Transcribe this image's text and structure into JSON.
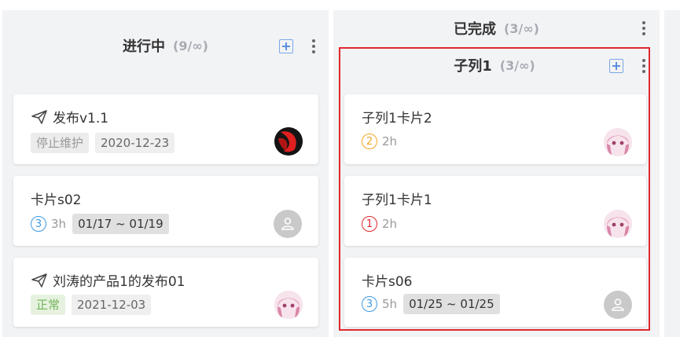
{
  "columns": {
    "in_progress": {
      "title": "进行中",
      "count": "(9/∞)"
    },
    "done": {
      "title": "已完成",
      "count": "(3/∞)"
    },
    "sub1": {
      "title": "子列1",
      "count": "(3/∞)"
    }
  },
  "cards_left": [
    {
      "title": "发布v1.1",
      "tag": "停止维护",
      "date": "2020-12-23",
      "avatar": "red-black-logo-avatar"
    },
    {
      "title": "卡片s02",
      "priority": "3",
      "hours": "3h",
      "range": "01/17 ~ 01/19",
      "avatar": "default-user-avatar"
    },
    {
      "title": "刘涛的产品1的发布01",
      "tag": "正常",
      "date": "2021-12-03",
      "avatar": "anime-girl-avatar"
    }
  ],
  "cards_right": [
    {
      "title": "子列1卡片2",
      "priority": "2",
      "hours": "2h",
      "avatar": "anime-girl-avatar"
    },
    {
      "title": "子列1卡片1",
      "priority": "1",
      "hours": "2h",
      "avatar": "anime-girl-avatar"
    },
    {
      "title": "卡片s06",
      "priority": "3",
      "hours": "5h",
      "range": "01/25 ~ 01/25",
      "avatar": "default-user-avatar"
    }
  ],
  "colors": {
    "priority_1": "#e0282e",
    "priority_2": "#f5a623",
    "priority_3": "#3f9ae0",
    "highlight_border": "#e0282e"
  }
}
